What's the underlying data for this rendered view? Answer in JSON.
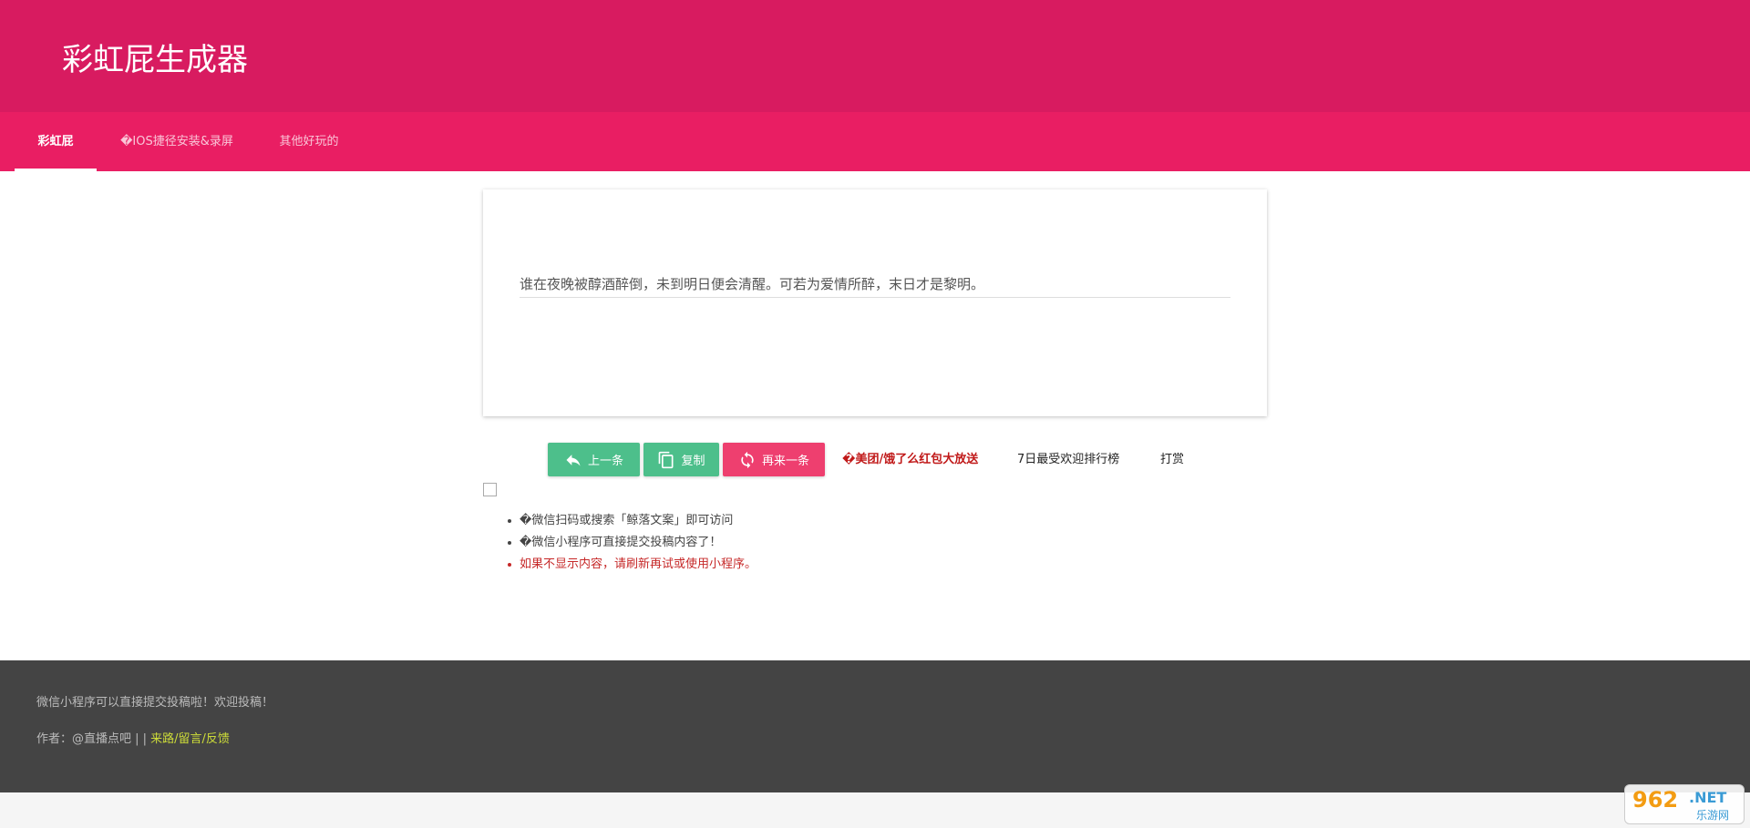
{
  "header": {
    "title": "彩虹屁生成器"
  },
  "nav": {
    "tabs": [
      {
        "label": "彩虹屁"
      },
      {
        "label": "�IOS捷径安装&录屏"
      },
      {
        "label": "其他好玩的"
      }
    ]
  },
  "card": {
    "quote": "谁在夜晚被醇酒醉倒，未到明日便会清醒。可若为爱情所醉，末日才是黎明。"
  },
  "actions": {
    "prev_label": "上一条",
    "copy_label": "复制",
    "next_label": "再来一条",
    "promo_label": "�美团/饿了么红包大放送",
    "ranking_label": "7日最受欢迎排行榜",
    "reward_label": "打赏"
  },
  "notes": [
    "�微信扫码或搜索「鲸落文案」即可访问",
    "�微信小程序可直接提交投稿内容了！",
    "如果不显示内容，请刷新再试或使用小程序。"
  ],
  "footer": {
    "line1": "微信小程序可以直接提交投稿啦！欢迎投稿！",
    "author_prefix": "作者：@直播点吧 | | ",
    "feedback_link": "来路/留言/反馈"
  },
  "watermark": {
    "num": "962",
    "net": ".NET",
    "cn": "乐游网"
  },
  "colors": {
    "header_bg": "#d81b60",
    "nav_bg": "#e91e63",
    "button_green": "#4dbf8b",
    "button_pink": "#ee3f6f",
    "footer_bg": "#444444",
    "link_yellow": "#cddc39"
  }
}
